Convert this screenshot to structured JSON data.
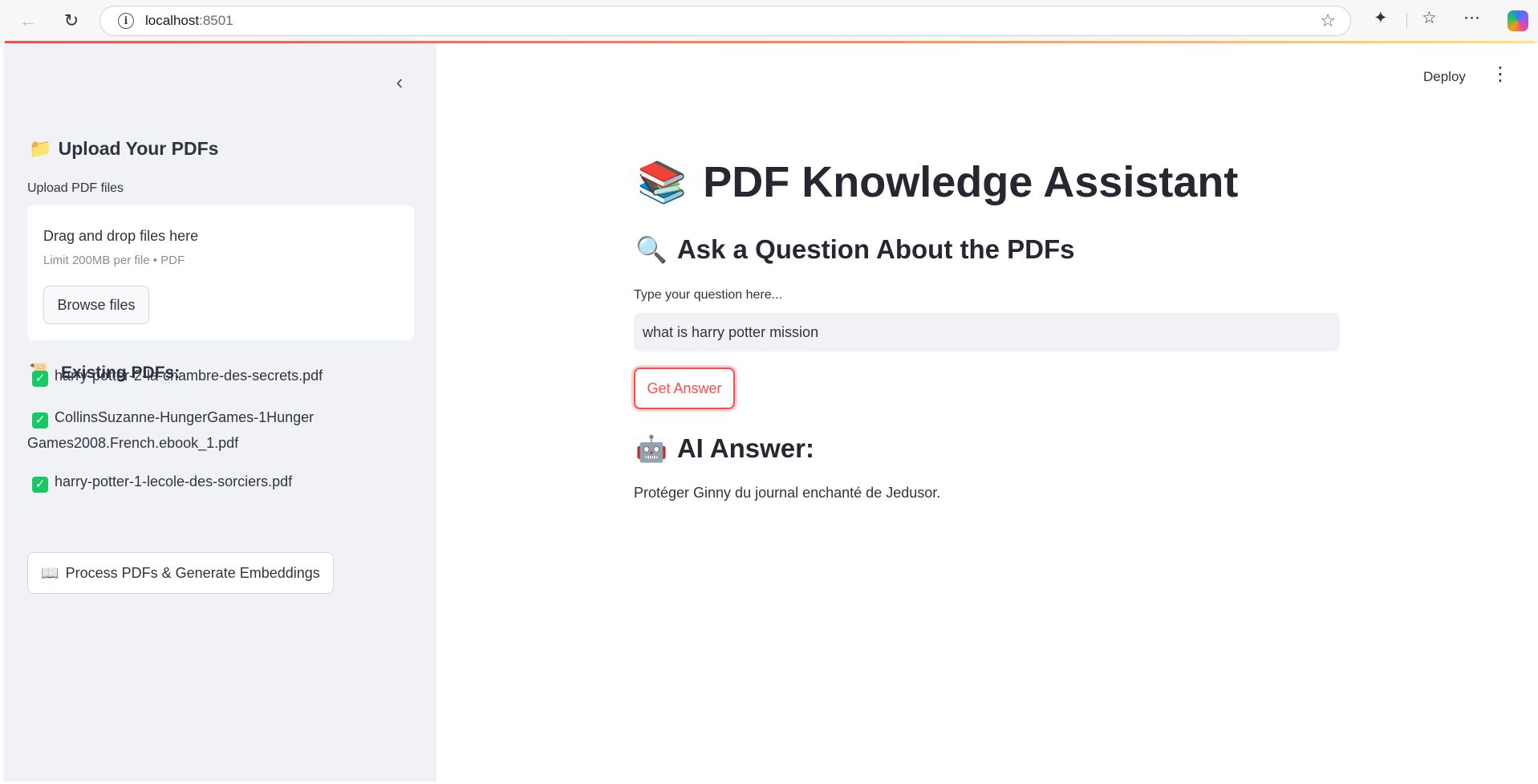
{
  "browser": {
    "url_host": "localhost",
    "url_port": ":8501"
  },
  "sidebar": {
    "upload_heading_icon": "folder-icon",
    "upload_heading": "Upload Your PDFs",
    "upload_label": "Upload PDF files",
    "dropzone": {
      "title": "Drag and drop files here",
      "limit": "Limit 200MB per file • PDF",
      "browse_label": "Browse files"
    },
    "existing_icon": "scroll-icon",
    "existing_heading": "Existing PDFs:",
    "pdfs": [
      "harry-potter-2-la-chambre-des-secrets.pdf",
      "CollinsSuzanne-HungerGames-1HungerGames2008.French.ebook_1.pdf",
      "harry-potter-1-lecole-des-sorciers.pdf"
    ],
    "process_icon": "open-book-icon",
    "process_label": "Process PDFs & Generate Embeddings"
  },
  "header": {
    "deploy_label": "Deploy"
  },
  "main": {
    "title": "PDF Knowledge Assistant",
    "ask_heading": "Ask a Question About the PDFs",
    "question_label": "Type your question here...",
    "question_value": "what is harry potter mission",
    "get_answer_label": "Get Answer",
    "answer_heading": "AI Answer:",
    "answer_text": "Protéger Ginny du journal enchanté de Jedusor."
  },
  "colors": {
    "accent": "#ff4b4b",
    "sidebar_bg": "#f0f2f6",
    "check_green": "#17c964"
  }
}
